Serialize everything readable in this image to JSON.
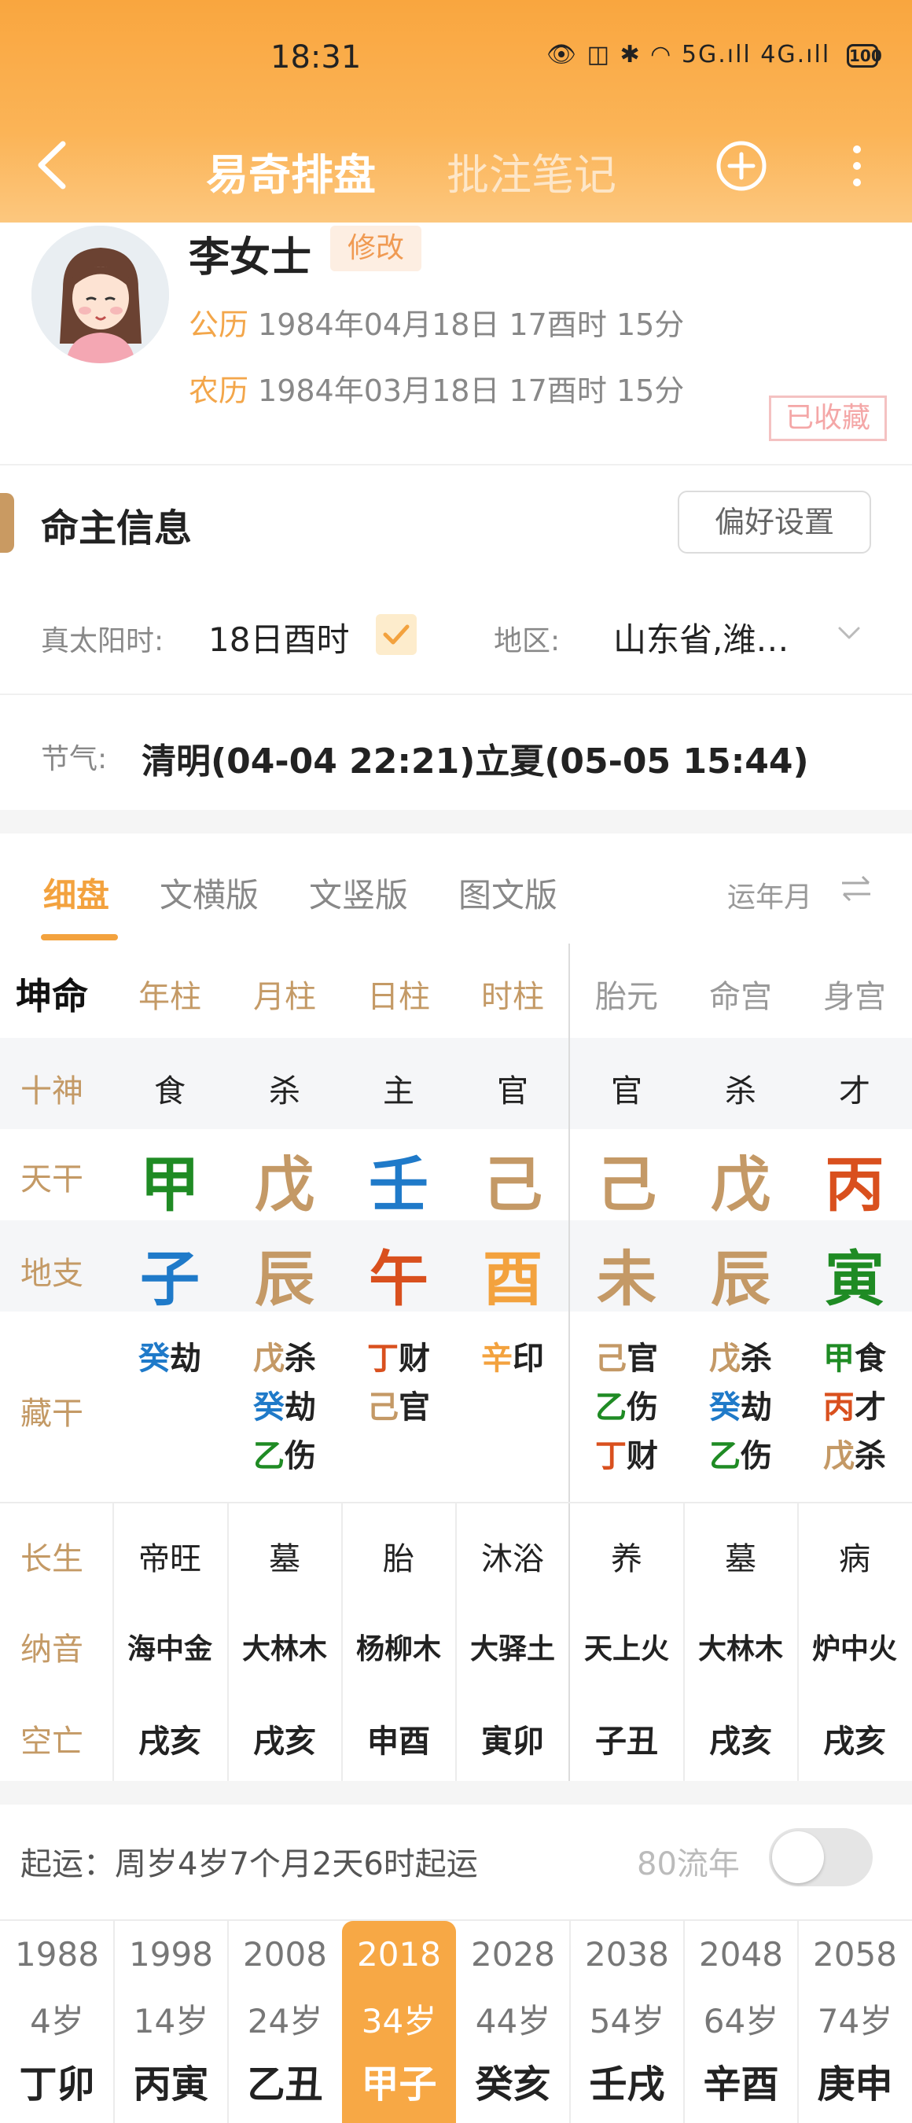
{
  "status_bar": {
    "time": "18:31",
    "icons": "👁 ◫ ✱ ◠ 5G.ıll 4G.ıll",
    "battery": "100"
  },
  "nav": {
    "tab_active": "易奇排盘",
    "tab_inactive": "批注笔记",
    "back_icon": "chevron-left",
    "add_icon": "plus-circle",
    "more_icon": "more-vertical"
  },
  "profile": {
    "name": "李女士",
    "edit_label": "修改",
    "solar_label": "公历",
    "solar_date": "1984年04月18日 17酉时 15分",
    "lunar_label": "农历",
    "lunar_date": "1984年03月18日 17酉时 15分",
    "stamp": "已收藏"
  },
  "section": {
    "title": "命主信息",
    "pref_button": "偏好设置"
  },
  "info": {
    "solar_time_label": "真太阳时:",
    "solar_time_value": "18日酉时",
    "region_label": "地区:",
    "region_value": "山东省,潍…",
    "jieqi_label": "节气:",
    "jieqi_value": "清明(04-04 22:21)立夏(05-05 15:44)"
  },
  "panel_tabs": {
    "tabs": [
      "细盘",
      "文横版",
      "文竖版",
      "图文版"
    ],
    "right_label": "运年月",
    "swap_icon": "⇌"
  },
  "chart": {
    "corner": "坤命",
    "headers": [
      "年柱",
      "月柱",
      "日柱",
      "时柱",
      "胎元",
      "命宫",
      "身宫"
    ],
    "row_labels": {
      "shishen": "十神",
      "tiangan": "天干",
      "dizhi": "地支",
      "canggan": "藏干",
      "changsheng": "长生",
      "nayin": "纳音",
      "kongwang": "空亡"
    },
    "shishen": [
      "食",
      "杀",
      "主",
      "官",
      "官",
      "杀",
      "才"
    ],
    "tiangan": [
      "甲",
      "戊",
      "壬",
      "己",
      "己",
      "戊",
      "丙"
    ],
    "dizhi": [
      "子",
      "辰",
      "午",
      "酉",
      "未",
      "辰",
      "寅"
    ],
    "canggan": [
      [
        {
          "g": "癸",
          "s": "劫",
          "c": "blue"
        }
      ],
      [
        {
          "g": "戊",
          "s": "杀",
          "c": "tan"
        },
        {
          "g": "癸",
          "s": "劫",
          "c": "blue"
        },
        {
          "g": "乙",
          "s": "伤",
          "c": "green"
        }
      ],
      [
        {
          "g": "丁",
          "s": "财",
          "c": "red"
        },
        {
          "g": "己",
          "s": "官",
          "c": "tan"
        }
      ],
      [
        {
          "g": "辛",
          "s": "印",
          "c": "orange"
        }
      ],
      [
        {
          "g": "己",
          "s": "官",
          "c": "tan"
        },
        {
          "g": "乙",
          "s": "伤",
          "c": "green"
        },
        {
          "g": "丁",
          "s": "财",
          "c": "red"
        }
      ],
      [
        {
          "g": "戊",
          "s": "杀",
          "c": "tan"
        },
        {
          "g": "癸",
          "s": "劫",
          "c": "blue"
        },
        {
          "g": "乙",
          "s": "伤",
          "c": "green"
        }
      ],
      [
        {
          "g": "甲",
          "s": "食",
          "c": "green"
        },
        {
          "g": "丙",
          "s": "才",
          "c": "red"
        },
        {
          "g": "戊",
          "s": "杀",
          "c": "tan"
        }
      ]
    ],
    "changsheng": [
      "帝旺",
      "墓",
      "胎",
      "沐浴",
      "养",
      "墓",
      "病"
    ],
    "nayin": [
      "海中金",
      "大林木",
      "杨柳木",
      "大驿土",
      "天上火",
      "大林木",
      "炉中火"
    ],
    "kongwang": [
      "戌亥",
      "戌亥",
      "申酉",
      "寅卯",
      "子丑",
      "戌亥",
      "戌亥"
    ]
  },
  "qiyun": {
    "text": "起运：周岁4岁7个月2天6时起运",
    "liunian_label": "80流年",
    "toggle_on": false
  },
  "dayun": [
    {
      "year": "1988",
      "age": "4岁",
      "gz": "丁卯"
    },
    {
      "year": "1998",
      "age": "14岁",
      "gz": "丙寅"
    },
    {
      "year": "2008",
      "age": "24岁",
      "gz": "乙丑"
    },
    {
      "year": "2018",
      "age": "34岁",
      "gz": "甲子",
      "active": true
    },
    {
      "year": "2028",
      "age": "44岁",
      "gz": "癸亥"
    },
    {
      "year": "2038",
      "age": "54岁",
      "gz": "壬戌"
    },
    {
      "year": "2048",
      "age": "64岁",
      "gz": "辛酉"
    },
    {
      "year": "2058",
      "age": "74岁",
      "gz": "庚申"
    }
  ],
  "colors": {
    "accent": "#f3a23e",
    "green": "#1f8b24",
    "tan": "#c49966",
    "blue": "#1f7ac9",
    "red": "#d9501e"
  },
  "element_colors": {
    "tiangan": [
      "green",
      "tan",
      "blue",
      "tan",
      "tan",
      "tan",
      "red"
    ],
    "dizhi": [
      "blue",
      "tan",
      "red",
      "orange",
      "tan",
      "tan",
      "green"
    ]
  }
}
